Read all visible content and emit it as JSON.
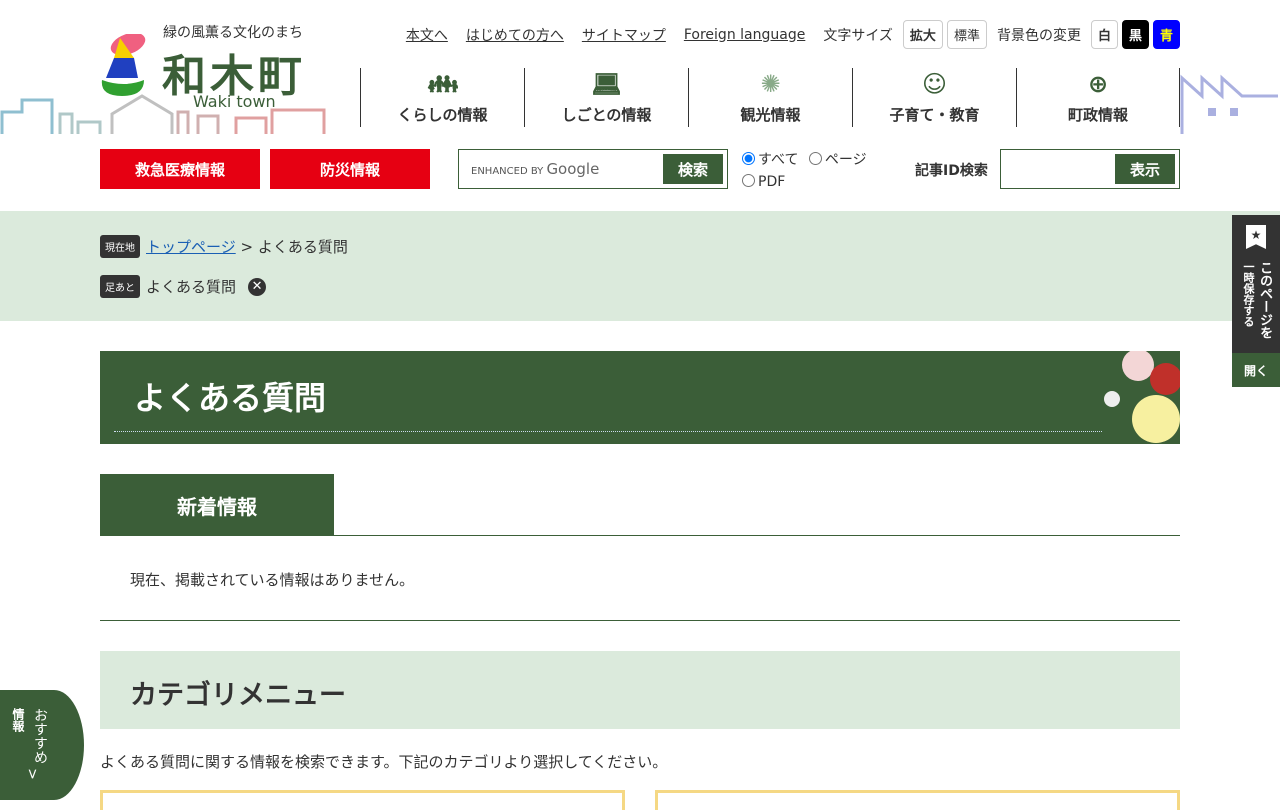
{
  "logo": {
    "tagline": "緑の風薫る文化のまち",
    "name": "和木町",
    "en": "Waki town"
  },
  "util": {
    "links": [
      "本文へ",
      "はじめての方へ",
      "サイトマップ",
      "Foreign language"
    ],
    "font_size_label": "文字サイズ",
    "font_large": "拡大",
    "font_normal": "標準",
    "bg_label": "背景色の変更",
    "bg_white": "白",
    "bg_black": "黒",
    "bg_blue": "青"
  },
  "gnav": [
    {
      "label": "くらしの情報",
      "icon": "family-icon"
    },
    {
      "label": "しごとの情報",
      "icon": "work-icon"
    },
    {
      "label": "観光情報",
      "icon": "fireworks-icon"
    },
    {
      "label": "子育て・教育",
      "icon": "child-icon"
    },
    {
      "label": "町政情報",
      "icon": "town-emblem-icon"
    }
  ],
  "emergency": "救急医療情報",
  "disaster": "防災情報",
  "search": {
    "enhanced": "ENHANCED BY",
    "google": "Google",
    "button": "検索",
    "opt_all": "すべて",
    "opt_page": "ページ",
    "opt_pdf": "PDF"
  },
  "article_id": {
    "label": "記事ID検索",
    "button": "表示"
  },
  "breadcrumb": {
    "tag": "現在地",
    "home": "トップページ",
    "sep": " > ",
    "current": "よくある質問"
  },
  "history": {
    "tag": "足あと",
    "item": "よくある質問"
  },
  "page_title": "よくある質問",
  "tab": "新着情報",
  "no_info": "現在、掲載されている情報はありません。",
  "category": {
    "title": "カテゴリメニュー",
    "desc": "よくある質問に関する情報を検索できます。下記のカテゴリより選択してください。"
  },
  "side": {
    "line1": "このページを",
    "line2": "一時保存する",
    "open": "開く"
  },
  "reco": {
    "line1": "おすすめ",
    "line2": "情報",
    "arrow": ">"
  },
  "colors": {
    "green": "#3b5e38",
    "red": "#e60012",
    "light": "#dbeadc"
  }
}
